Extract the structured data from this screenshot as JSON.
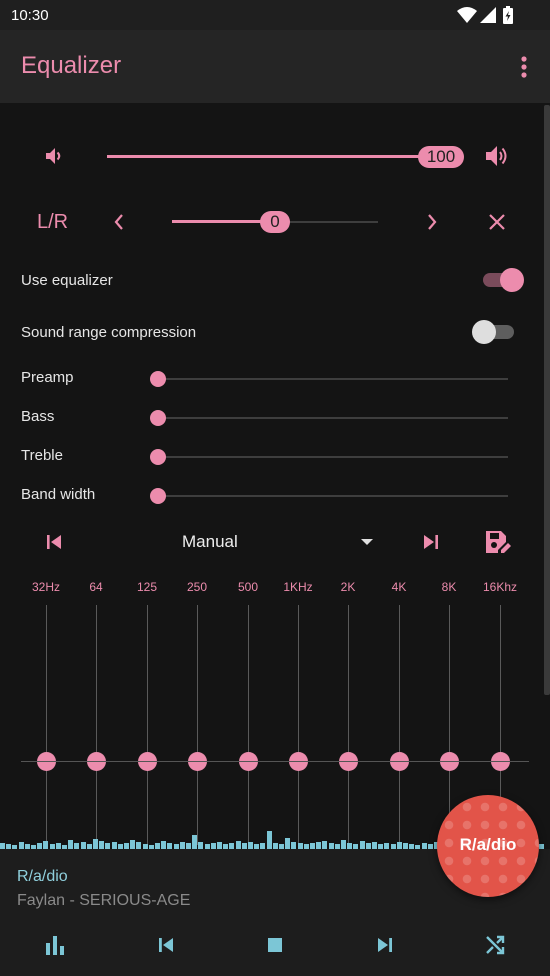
{
  "status_bar": {
    "time": "10:30"
  },
  "app_bar": {
    "title": "Equalizer"
  },
  "volume": {
    "value": "100",
    "fraction": 1.0
  },
  "balance": {
    "label": "L/R",
    "value": "0"
  },
  "toggles": {
    "use_equalizer": {
      "label": "Use equalizer",
      "on": true
    },
    "sound_range_compression": {
      "label": "Sound range compression",
      "on": false
    }
  },
  "effects": [
    {
      "label": "Preamp",
      "level": 0
    },
    {
      "label": "Bass",
      "level": 0
    },
    {
      "label": "Treble",
      "level": 0
    },
    {
      "label": "Band width",
      "level": 0
    }
  ],
  "preset": {
    "selected": "Manual"
  },
  "bands": [
    {
      "label": "32Hz",
      "level": 0
    },
    {
      "label": "64",
      "level": 0
    },
    {
      "label": "125",
      "level": 0
    },
    {
      "label": "250",
      "level": 0
    },
    {
      "label": "500",
      "level": 0
    },
    {
      "label": "1KHz",
      "level": 0
    },
    {
      "label": "2K",
      "level": 0
    },
    {
      "label": "4K",
      "level": 0
    },
    {
      "label": "8K",
      "level": 0
    },
    {
      "label": "16Khz",
      "level": 0
    }
  ],
  "now_playing": {
    "station": "R/a/dio",
    "track": "Faylan - SERIOUS-AGE"
  },
  "fab": {
    "label": "R/a/dio"
  },
  "colors": {
    "accent": "#ec8cad",
    "station_text": "#8fcfdc",
    "fab": "#e25449",
    "visualizer": "#7cc6d6"
  },
  "icons": {
    "status": [
      "wifi-icon",
      "signal-icon",
      "battery-icon"
    ],
    "app_bar": "more-vert-icon",
    "volume": [
      "volume-down-icon",
      "volume-up-icon"
    ],
    "balance": [
      "chevron-left-icon",
      "chevron-right-icon",
      "close-icon"
    ],
    "preset": [
      "skip-previous-icon",
      "dropdown-arrow-icon",
      "skip-next-icon",
      "save-edit-icon"
    ],
    "player": [
      "equalizer-icon",
      "skip-previous-icon",
      "stop-icon",
      "skip-next-icon",
      "shuffle-icon"
    ]
  }
}
